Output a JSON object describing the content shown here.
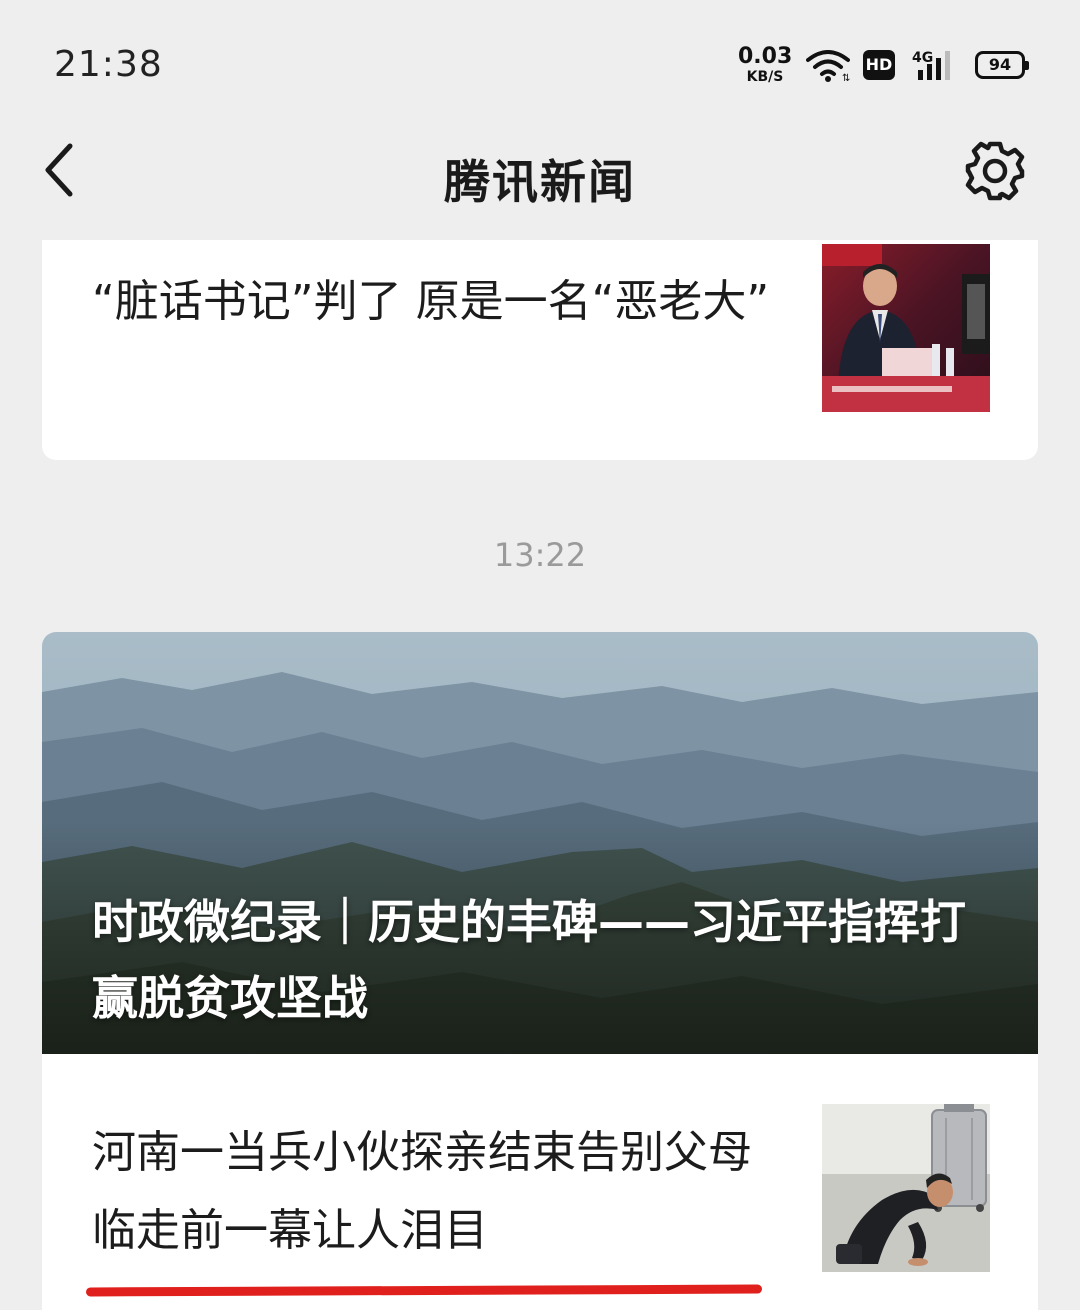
{
  "status_bar": {
    "time": "21:38",
    "net_speed_value": "0.03",
    "net_speed_unit": "KB/S",
    "hd_badge": "HD",
    "network_type": "4G",
    "battery_level": "94"
  },
  "nav": {
    "title": "腾讯新闻",
    "back_icon": "chevron-left-icon",
    "settings_icon": "gear-icon"
  },
  "feed": {
    "item1": {
      "headline": "“脏话书记”判了 原是一名“恶老大”"
    },
    "timestamp": "13:22",
    "featured": {
      "headline": "时政微纪录｜历史的丰碑——习近平指挥打赢脱贫攻坚战"
    },
    "item2": {
      "headline": "河南一当兵小伙探亲结束告别父母 临走前一幕让人泪目"
    }
  },
  "colors": {
    "page_background": "#eeeeee",
    "card_background": "#ffffff",
    "underline_accent": "#e0201c",
    "timestamp_text": "#9a9a9a"
  }
}
